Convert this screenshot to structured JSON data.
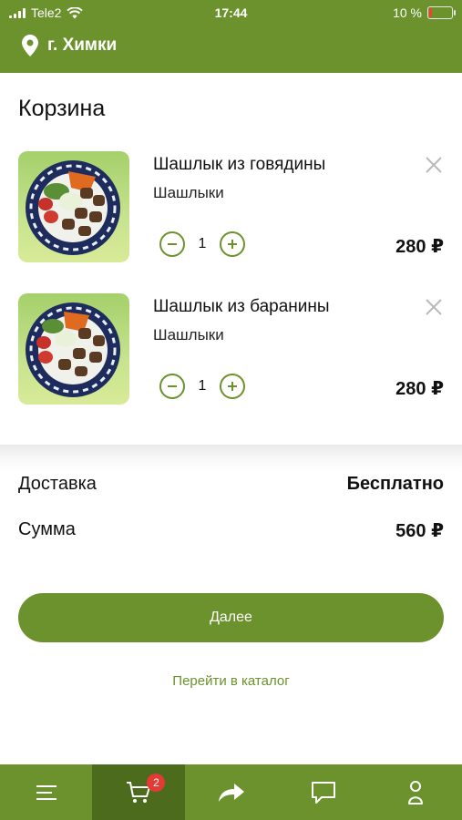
{
  "status_bar": {
    "carrier": "Tele2",
    "time": "17:44",
    "battery": "10 %"
  },
  "header": {
    "city": "г. Химки"
  },
  "cart": {
    "title": "Корзина",
    "items": [
      {
        "name": "Шашлык из говядины",
        "category": "Шашлыки",
        "quantity": "1",
        "price": "280 ₽"
      },
      {
        "name": "Шашлык из баранины",
        "category": "Шашлыки",
        "quantity": "1",
        "price": "280 ₽"
      }
    ]
  },
  "summary": {
    "delivery_label": "Доставка",
    "delivery_value": "Бесплатно",
    "total_label": "Сумма",
    "total_value": "560 ₽"
  },
  "actions": {
    "next_label": "Далее",
    "catalog_link": "Перейти в каталог"
  },
  "tabbar": {
    "tabs": [
      {
        "icon": "menu-icon"
      },
      {
        "icon": "cart-icon",
        "badge": "2",
        "active": true
      },
      {
        "icon": "share-icon"
      },
      {
        "icon": "chat-icon"
      },
      {
        "icon": "user-icon"
      }
    ]
  },
  "colors": {
    "brand": "#6b922c",
    "brand_dark": "#4c6b1c",
    "badge": "#e53935"
  }
}
